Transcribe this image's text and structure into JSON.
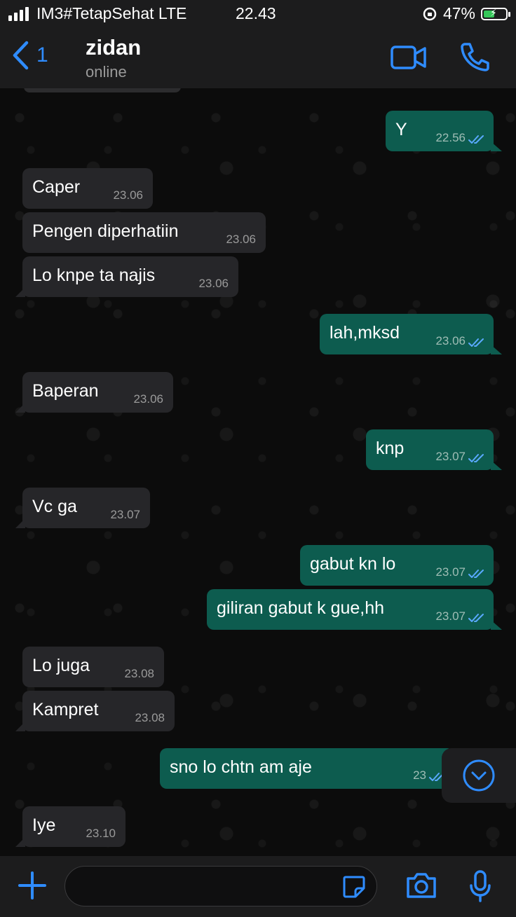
{
  "status_bar": {
    "carrier": "IM3#TetapSehat LTE",
    "time": "22.43",
    "battery": "47%"
  },
  "header": {
    "back_count": "1",
    "name": "zidan",
    "status": "online"
  },
  "messages": [
    {
      "dir": "out",
      "text": "Y",
      "time": "22.56",
      "read": true
    },
    {
      "dir": "in",
      "text": "Caper",
      "time": "23.06"
    },
    {
      "dir": "in",
      "text": "Pengen diperhatiin",
      "time": "23.06"
    },
    {
      "dir": "in",
      "text": "Lo knpe ta najis",
      "time": "23.06"
    },
    {
      "dir": "out",
      "text": "lah,mksd",
      "time": "23.06",
      "read": true
    },
    {
      "dir": "in",
      "text": "Baperan",
      "time": "23.06"
    },
    {
      "dir": "out",
      "text": "knp",
      "time": "23.07",
      "read": true
    },
    {
      "dir": "in",
      "text": "Vc ga",
      "time": "23.07"
    },
    {
      "dir": "out",
      "text": "gabut kn lo",
      "time": "23.07",
      "read": true
    },
    {
      "dir": "out",
      "text": "giliran gabut k gue,hh",
      "time": "23.07",
      "read": true
    },
    {
      "dir": "in",
      "text": "Lo juga",
      "time": "23.08"
    },
    {
      "dir": "in",
      "text": "Kampret",
      "time": "23.08"
    },
    {
      "dir": "out",
      "text": "sno lo chtn am            aje",
      "time": "23",
      "read": true
    },
    {
      "dir": "in",
      "text": "Iye",
      "time": "23.10"
    }
  ],
  "input": {
    "placeholder": ""
  },
  "colors": {
    "accent": "#2f8cff",
    "outgoing": "#0d5c4f",
    "incoming": "#262629",
    "battery": "#35c759"
  }
}
